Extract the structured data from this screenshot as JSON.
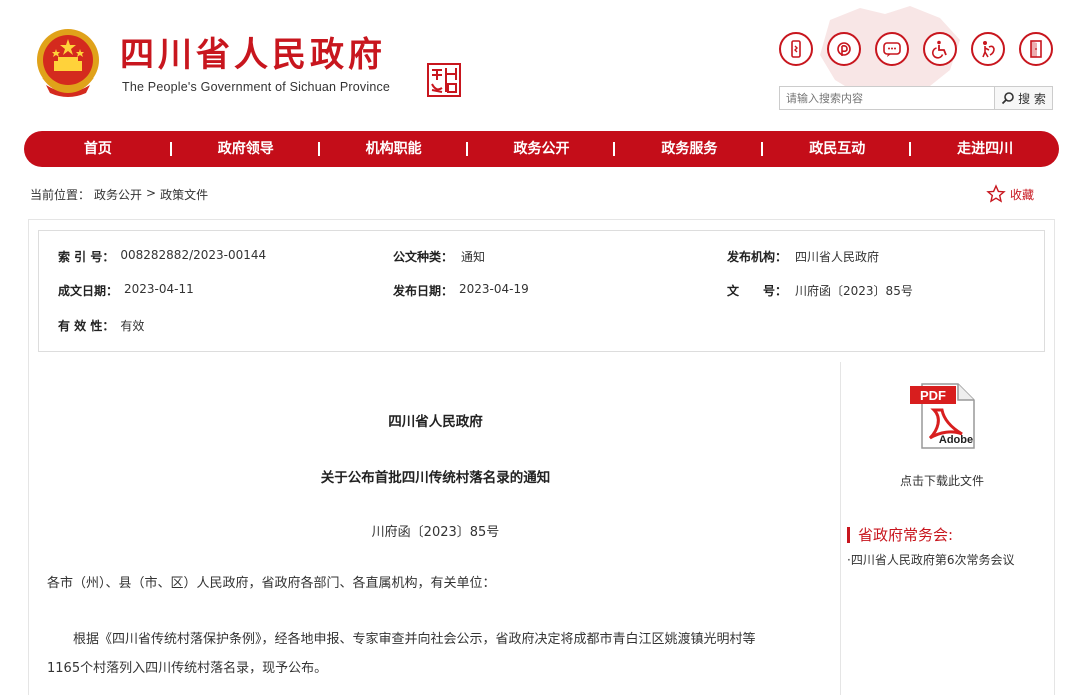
{
  "header": {
    "title": "四川省人民政府",
    "subtitle": "The People's Government of Sichuan Province",
    "icons": [
      "mobile-icon",
      "weibo-icon",
      "wechat-icon",
      "accessibility-icon",
      "elderly-care-icon",
      "exit-icon"
    ],
    "search_placeholder": "请输入搜索内容",
    "search_label": "搜 索"
  },
  "nav": {
    "items": [
      "首页",
      "政府领导",
      "机构职能",
      "政务公开",
      "政务服务",
      "政民互动",
      "走进四川"
    ]
  },
  "breadcrumb": {
    "prefix": "当前位置：",
    "items": [
      "政务公开",
      "政策文件"
    ],
    "separator": ">"
  },
  "favorite": {
    "label": "收藏"
  },
  "meta": {
    "index_no_key": "索 引 号：",
    "index_no": "008282882/2023-00144",
    "doc_type_key": "公文种类：",
    "doc_type": "通知",
    "issuer_key": "发布机构：",
    "issuer": "四川省人民政府",
    "written_date_key": "成文日期：",
    "written_date": "2023-04-11",
    "publish_date_key": "发布日期：",
    "publish_date": "2023-04-19",
    "doc_no_key": "文　　号：",
    "doc_no": "川府函〔2023〕85号",
    "validity_key": "有 效 性：",
    "validity": "有效"
  },
  "document": {
    "issuer_title": "四川省人民政府",
    "title": "关于公布首批四川传统村落名录的通知",
    "number": "川府函〔2023〕85号",
    "salutation": "各市（州）、县（市、区）人民政府，省政府各部门、各直属机构，有关单位：",
    "body_line1": "根据《四川省传统村落保护条例》，经各地申报、专家审查并向社会公示，省政府决定将成都市青白江区姚渡镇光明村等",
    "body_line2": "1165个村落列入四川传统村落名录，现予公布。"
  },
  "sidebar": {
    "pdf_badge": "PDF",
    "pdf_brand": "Adobe",
    "download_label": "点击下载此文件",
    "section_title": "省政府常务会:",
    "items": [
      "·四川省人民政府第6次常务会议"
    ]
  },
  "colors": {
    "brand_red": "#c8161e",
    "nav_red": "#c40d19"
  }
}
